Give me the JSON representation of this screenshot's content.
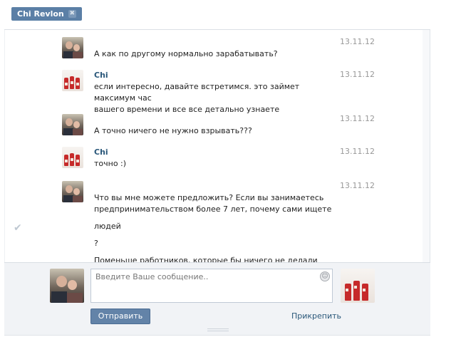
{
  "tab": {
    "label": "Chi Revlon",
    "close_glyph": "✖"
  },
  "messages": [
    {
      "author": "",
      "avatar": "user-photo",
      "date": "13.11.12",
      "lines": [
        "А как по другому нормально зарабатывать?"
      ]
    },
    {
      "author": "Chi",
      "avatar": "product-photo",
      "date": "13.11.12",
      "lines": [
        "если интересно, давайте встретимся. это займет максимум час",
        "вашего времени и все все детально узнаете"
      ]
    },
    {
      "author": "",
      "avatar": "user-photo",
      "date": "13.11.12",
      "lines": [
        "А точно ничего не нужно взрывать???"
      ]
    },
    {
      "author": "Chi",
      "avatar": "product-photo",
      "date": "13.11.12",
      "lines": [
        "точно :)"
      ]
    },
    {
      "author": "",
      "avatar": "user-photo",
      "date": "13.11.12",
      "lines": [
        "Что вы мне можете предложить? Если вы занимаетесь",
        "предпринимательством более 7 лет, почему сами ищете",
        "людей",
        "?",
        "Поменьше работников, которые бы ничего не делали"
      ]
    }
  ],
  "composer": {
    "placeholder": "Введите Ваше сообщение..",
    "send_label": "Отправить",
    "attach_label": "Прикрепить"
  },
  "icons": {
    "check": "✔",
    "smile": "☺"
  }
}
